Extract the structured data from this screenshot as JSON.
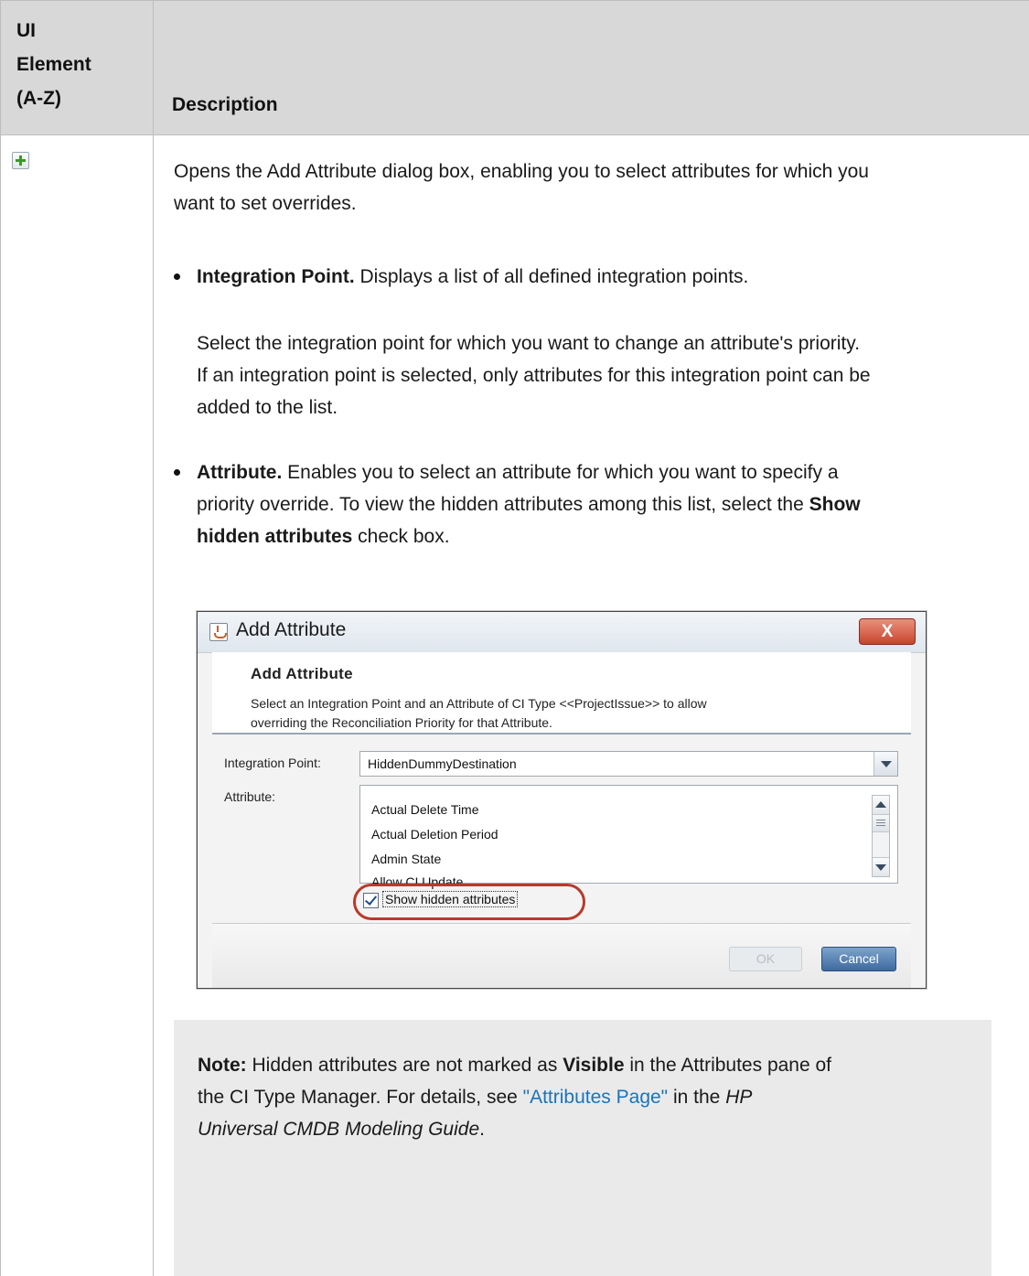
{
  "table": {
    "col1_header": "UI Element (A-Z)",
    "col1_header_lines": [
      "UI",
      "Element",
      "(A-Z)"
    ],
    "col2_header": "Description",
    "row_icon": "add-plus-icon"
  },
  "description": {
    "intro": "Opens the Add Attribute dialog box, enabling you to select attributes for which you want to set overrides.",
    "intro_lines": [
      "Opens the Add Attribute dialog box, enabling you to select attributes for which you",
      "want to set overrides."
    ],
    "bullet1_title": "Integration Point.",
    "bullet1_text": " Displays a list of all defined integration points.",
    "bullet1_sub_lines": [
      "Select the integration point for which you want to change an attribute's priority.",
      "If an integration point is selected, only attributes for this integration point can be",
      "added to the list."
    ],
    "bullet2_title": "Attribute.",
    "bullet2_line1": " Enables you to select an attribute for which you want to specify a",
    "bullet2_line2_pre": "priority override. To view the hidden attributes among this list, select the ",
    "bullet2_line2_bold": "Show",
    "bullet2_line3_bold": "hidden attributes",
    "bullet2_line3_post": " check box."
  },
  "dialog": {
    "window_title": "Add Attribute",
    "close_label": "X",
    "header_title": "Add Attribute",
    "header_description_lines": [
      "Select an Integration Point and an Attribute of CI Type <<ProjectIssue>> to allow",
      "overriding the Reconciliation Priority for that Attribute."
    ],
    "integration_point_label": "Integration Point:",
    "integration_point_value": "HiddenDummyDestination",
    "attribute_label": "Attribute:",
    "attribute_items": [
      "Actual Delete Time",
      "Actual Deletion Period",
      "Admin State",
      "Allow CI Update"
    ],
    "show_hidden_label": "Show hidden attributes",
    "show_hidden_checked": true,
    "ok_label": "OK",
    "cancel_label": "Cancel",
    "highlight_color": "#b73a2b"
  },
  "note": {
    "label": "Note:",
    "t1": " Hidden attributes are not marked as ",
    "visible_word": "Visible",
    "t2": " in the Attributes pane of",
    "t3": "the CI Type Manager. For details, see ",
    "link_text": "\"Attributes Page\"",
    "t4": " in the ",
    "guide_1": "HP",
    "guide_2": "Universal CMDB Modeling Guide",
    "t5": "."
  },
  "colors": {
    "header_bg": "#d8d8d8",
    "note_bg": "#eaeaea",
    "link": "#1a74b9"
  }
}
